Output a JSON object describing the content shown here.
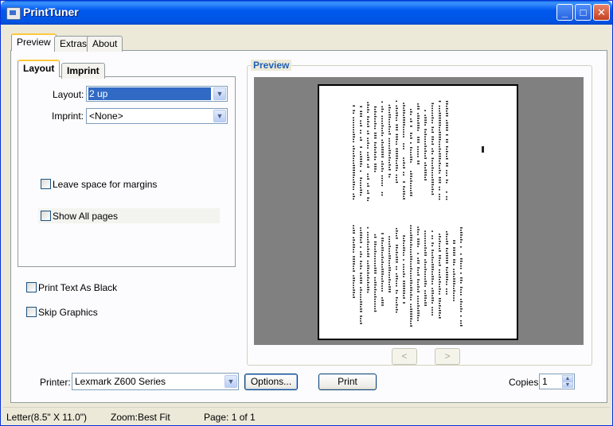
{
  "window": {
    "title": "PrintTuner"
  },
  "title_buttons": {
    "minimize": "_",
    "maximize": "□",
    "close": "✕"
  },
  "main_tabs": [
    {
      "label": "Preview",
      "active": true
    },
    {
      "label": "Extras",
      "active": false
    },
    {
      "label": "About",
      "active": false
    }
  ],
  "sub_tabs": [
    {
      "label": "Layout",
      "active": true
    },
    {
      "label": "Imprint",
      "active": false
    }
  ],
  "layout_form": {
    "layout_label": "Layout:",
    "layout_value": "2 up",
    "imprint_label": "Imprint:",
    "imprint_value": "<None>",
    "margins_label": "Leave space for margins",
    "margins_checked": false,
    "show_all_label": "Show All pages",
    "show_all_checked": false
  },
  "options": {
    "print_black_label": "Print Text As Black",
    "print_black_checked": false,
    "skip_graphics_label": "Skip Graphics",
    "skip_graphics_checked": false
  },
  "preview": {
    "group_title": "Preview",
    "prev_label": "<",
    "next_label": ">"
  },
  "bottom": {
    "printer_label": "Printer:",
    "printer_value": "Lexmark Z600 Series",
    "options_button": "Options...",
    "print_button": "Print",
    "copies_label": "Copies:",
    "copies_value": "1"
  },
  "status": {
    "paper": "Letter(8.5\" X 11.0\")",
    "zoom": "Zoom:Best Fit",
    "page": "Page: 1 of 1"
  },
  "colors": {
    "titlebar": "#0054e3",
    "face": "#ece9d8",
    "selection": "#316ac5",
    "group_title": "#1f5fb5"
  }
}
